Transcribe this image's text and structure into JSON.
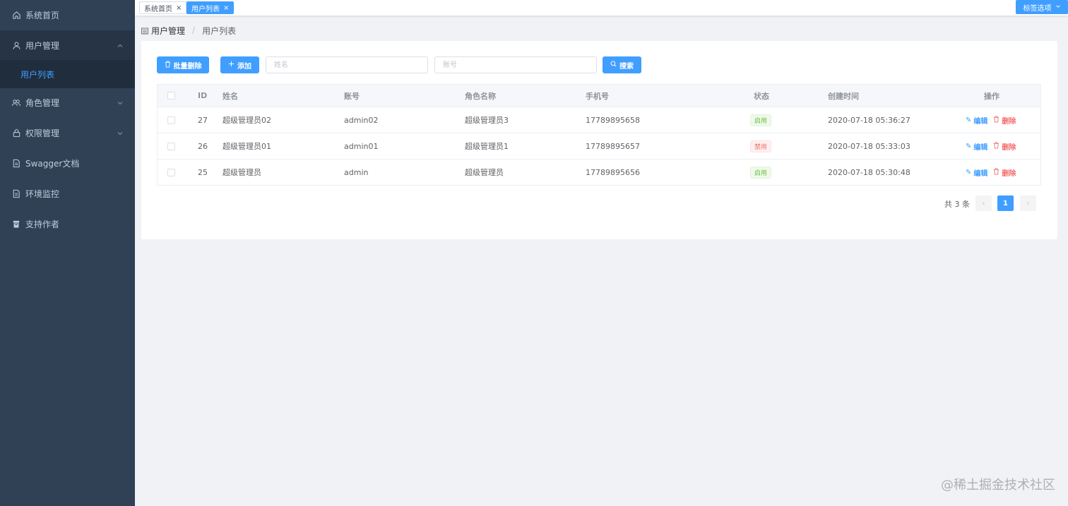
{
  "sidebar": {
    "items": [
      {
        "label": "系统首页",
        "icon": "home-icon"
      },
      {
        "label": "用户管理",
        "icon": "user-icon",
        "expanded": true
      },
      {
        "label": "用户列表",
        "icon": "",
        "active": true
      },
      {
        "label": "角色管理",
        "icon": "users-icon"
      },
      {
        "label": "权限管理",
        "icon": "lock-icon"
      },
      {
        "label": "Swagger文档",
        "icon": "document-icon"
      },
      {
        "label": "环境监控",
        "icon": "document-icon"
      },
      {
        "label": "支持作者",
        "icon": "gift-icon"
      }
    ]
  },
  "tags": {
    "items": [
      {
        "label": "系统首页",
        "active": false
      },
      {
        "label": "用户列表",
        "active": true
      }
    ],
    "close_symbol": "×",
    "option_label": "标签选项"
  },
  "breadcrumb": {
    "items": [
      "用户管理",
      "用户列表"
    ],
    "separator": "/"
  },
  "toolbar": {
    "batch_delete_label": "批量删除",
    "add_label": "添加",
    "name_placeholder": "姓名",
    "account_placeholder": "账号",
    "search_label": "搜索"
  },
  "table": {
    "columns": [
      "ID",
      "姓名",
      "账号",
      "角色名称",
      "手机号",
      "状态",
      "创建时间",
      "操作"
    ],
    "rows": [
      {
        "id": "27",
        "name": "超级管理员02",
        "account": "admin02",
        "role": "超级管理员3",
        "phone": "17789895658",
        "status": "启用",
        "status_type": "ok",
        "created": "2020-07-18 05:36:27"
      },
      {
        "id": "26",
        "name": "超级管理员01",
        "account": "admin01",
        "role": "超级管理员1",
        "phone": "17789895657",
        "status": "禁用",
        "status_type": "off",
        "created": "2020-07-18 05:33:03"
      },
      {
        "id": "25",
        "name": "超级管理员",
        "account": "admin",
        "role": "超级管理员",
        "phone": "17789895656",
        "status": "启用",
        "status_type": "ok",
        "created": "2020-07-18 05:30:48"
      }
    ],
    "edit_label": "编辑",
    "delete_label": "删除"
  },
  "pagination": {
    "total_label": "共 3 条",
    "current_page": "1",
    "prev_symbol": "‹",
    "next_symbol": "›"
  },
  "watermark": "@稀土掘金技术社区",
  "colors": {
    "sidebar_bg": "#304156",
    "primary": "#409eff",
    "success": "#67c23a",
    "danger": "#f56c6c"
  }
}
